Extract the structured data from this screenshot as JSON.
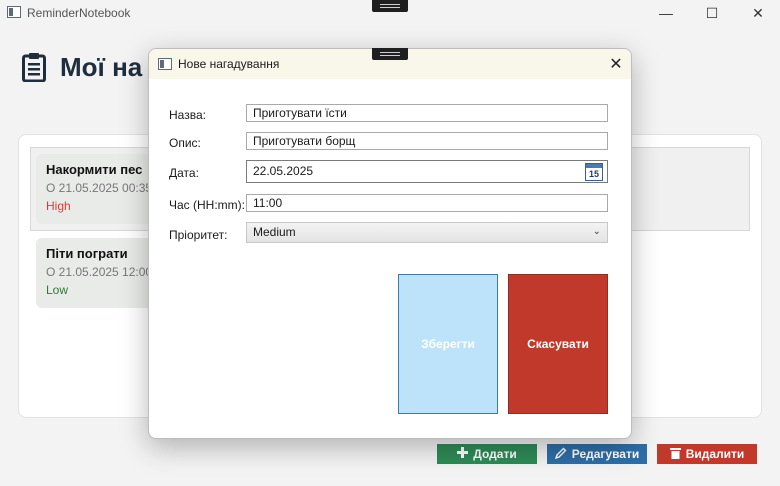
{
  "window": {
    "title": "ReminderNotebook",
    "controls": {
      "minimize": "—",
      "maximize": "☐",
      "close": "✕"
    }
  },
  "main": {
    "title": "Мої на",
    "reminders": [
      {
        "title": "Накормити пес",
        "date": "О 21.05.2025 00:35",
        "priority": "High",
        "priority_color": "#e53935"
      },
      {
        "title": "Піти пограти",
        "date": "О 21.05.2025 12:00",
        "priority": "Low",
        "priority_color": "#2e7d32"
      }
    ],
    "buttons": {
      "add": "Додати",
      "edit": "Редагувати",
      "delete": "Видалити"
    }
  },
  "dialog": {
    "title": "Нове нагадування",
    "close": "✕",
    "fields": {
      "name_label": "Назва:",
      "name_value": "Приготувати їсти",
      "description_label": "Опис:",
      "description_value": "Приготувати борщ",
      "date_label": "Дата:",
      "date_value": "22.05.2025",
      "calendar_day": "15",
      "time_label": "Час (HH:mm):",
      "time_value": "11:00",
      "priority_label": "Пріоритет:",
      "priority_value": "Medium",
      "priority_chevron": "⌄"
    },
    "buttons": {
      "save": "Зберегти",
      "cancel": "Скасувати"
    }
  },
  "colors": {
    "add_button": "#2e8b57",
    "edit_button": "#2e6ea6",
    "delete_button": "#c0392b",
    "save_button": "#bde3fb",
    "cancel_button": "#c0392b",
    "dialog_titlebar": "#f9f7ea"
  }
}
